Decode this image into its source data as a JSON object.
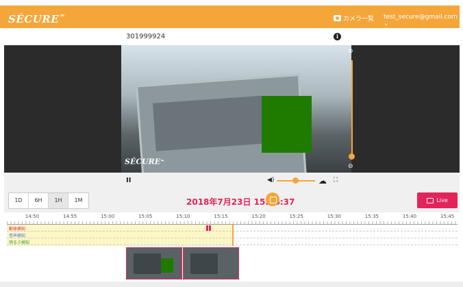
{
  "app": {
    "logo": "SÉCURE",
    "logo_mark": "ᆿ",
    "camera_list_label": "カメラ一覧",
    "user_email": "test_secure@gmail.com ⌄"
  },
  "camera": {
    "id": "301999924",
    "info_glyph": "i",
    "overlay_logo": "SÉCURE"
  },
  "player": {
    "pause_glyph": "II",
    "volume_glyph": "◀)",
    "cloud_glyph": "☁",
    "fullscreen_glyph": "⛶",
    "zoom_in_glyph": "⊕",
    "zoom_out_glyph": "⊖"
  },
  "range_buttons": [
    "1D",
    "6H",
    "1H",
    "1M"
  ],
  "active_range": "1H",
  "current_datetime": "2018年7月23日 15:16:37",
  "live_label": "Live",
  "timeline": {
    "ticks": [
      "14:50",
      "14:55",
      "15:00",
      "15:05",
      "15:10",
      "15:15",
      "15:20",
      "15:25",
      "15:30",
      "15:35",
      "15:40",
      "15:45"
    ],
    "lanes": [
      {
        "label": "動体検知",
        "color": "#e3245a"
      },
      {
        "label": "音声検知",
        "color": "#3a7fd0"
      },
      {
        "label": "明るさ検知",
        "color": "#3aa03a"
      }
    ]
  },
  "thumbnails_count": 2
}
